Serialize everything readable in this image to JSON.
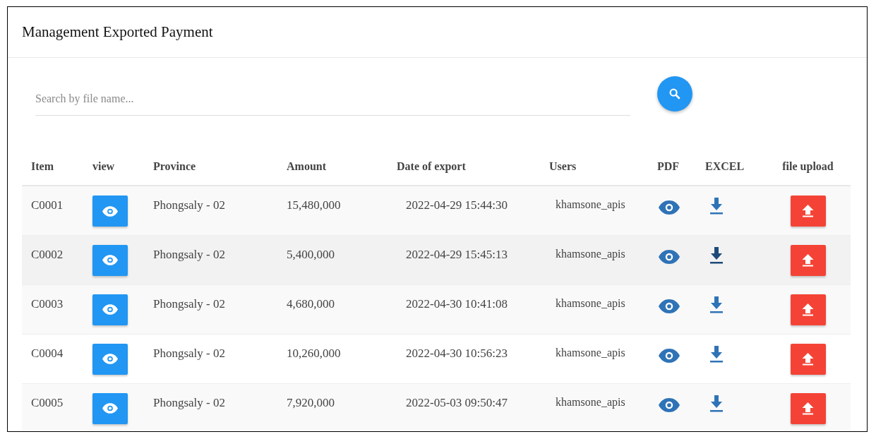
{
  "title": "Management Exported Payment",
  "search": {
    "placeholder": "Search by file name..."
  },
  "table": {
    "columns": [
      "Item",
      "view",
      "Province",
      "Amount",
      "Date of export",
      "Users",
      "PDF",
      "EXCEL",
      "file upload"
    ],
    "rows": [
      {
        "item": "C0001",
        "province": "Phongsaly - 02",
        "amount": "15,480,000",
        "date": "2022-04-29 15:44:30",
        "user": "khamsone_apis",
        "hovered": false
      },
      {
        "item": "C0002",
        "province": "Phongsaly - 02",
        "amount": "5,400,000",
        "date": "2022-04-29 15:45:13",
        "user": "khamsone_apis",
        "hovered": true
      },
      {
        "item": "C0003",
        "province": "Phongsaly - 02",
        "amount": "4,680,000",
        "date": "2022-04-30 10:41:08",
        "user": "khamsone_apis",
        "hovered": false
      },
      {
        "item": "C0004",
        "province": "Phongsaly - 02",
        "amount": "10,260,000",
        "date": "2022-04-30 10:56:23",
        "user": "khamsone_apis",
        "hovered": false
      },
      {
        "item": "C0005",
        "province": "Phongsaly - 02",
        "amount": "7,920,000",
        "date": "2022-05-03 09:50:47",
        "user": "khamsone_apis",
        "hovered": false
      }
    ]
  }
}
